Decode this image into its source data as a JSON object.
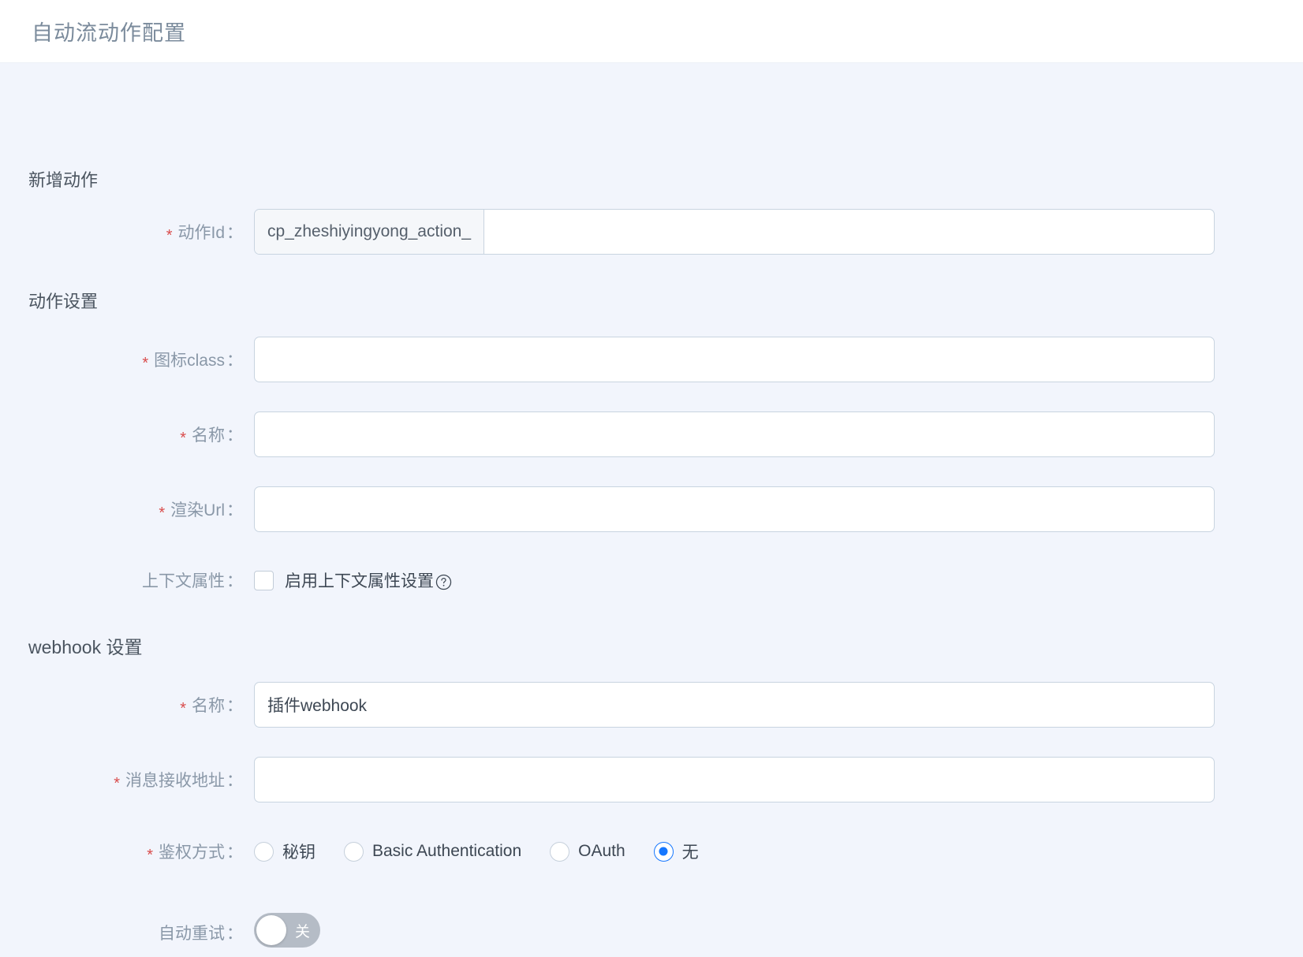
{
  "header": {
    "title": "自动流动作配置"
  },
  "sections": {
    "add_action": "新增动作",
    "action_settings": "动作设置",
    "webhook_settings": "webhook 设置"
  },
  "fields": {
    "action_id": {
      "label": "动作Id",
      "required_mark": "*",
      "colon": "：",
      "prefix": "cp_zheshiyingyong_action_",
      "value": "",
      "placeholder": ""
    },
    "icon_class": {
      "label": "图标class",
      "required_mark": "*",
      "colon": "：",
      "value": "",
      "placeholder": ""
    },
    "name": {
      "label": "名称",
      "required_mark": "*",
      "colon": "：",
      "value": "",
      "placeholder": ""
    },
    "render_url": {
      "label": "渲染Url",
      "required_mark": "*",
      "colon": "：",
      "value": "",
      "placeholder": ""
    },
    "context_attr": {
      "label": "上下文属性",
      "colon": "：",
      "checkbox_label": "启用上下文属性设置",
      "checked": false,
      "help_icon": "question-circle-icon"
    },
    "webhook_name": {
      "label": "名称",
      "required_mark": "*",
      "colon": "：",
      "value": "插件webhook",
      "placeholder": ""
    },
    "webhook_url": {
      "label": "消息接收地址",
      "required_mark": "*",
      "colon": "：",
      "value": "",
      "placeholder": ""
    },
    "auth_type": {
      "label": "鉴权方式",
      "required_mark": "*",
      "colon": "：",
      "options": [
        {
          "label": "秘钥",
          "checked": false
        },
        {
          "label": "Basic Authentication",
          "checked": false
        },
        {
          "label": "OAuth",
          "checked": false
        },
        {
          "label": "无",
          "checked": true
        }
      ]
    },
    "auto_retry": {
      "label": "自动重试",
      "colon": "：",
      "state_text": "关",
      "on": false
    }
  },
  "colors": {
    "page_bg": "#f2f5fc",
    "header_bg": "#ffffff",
    "title_text": "#7b8b9c",
    "label_text": "#8a98a8",
    "required_red": "#d94c4c",
    "accent_blue": "#1677ff",
    "input_border": "#c8d4e0",
    "addon_bg": "#f5f7fa",
    "switch_off_bg": "#b5bcc6"
  }
}
